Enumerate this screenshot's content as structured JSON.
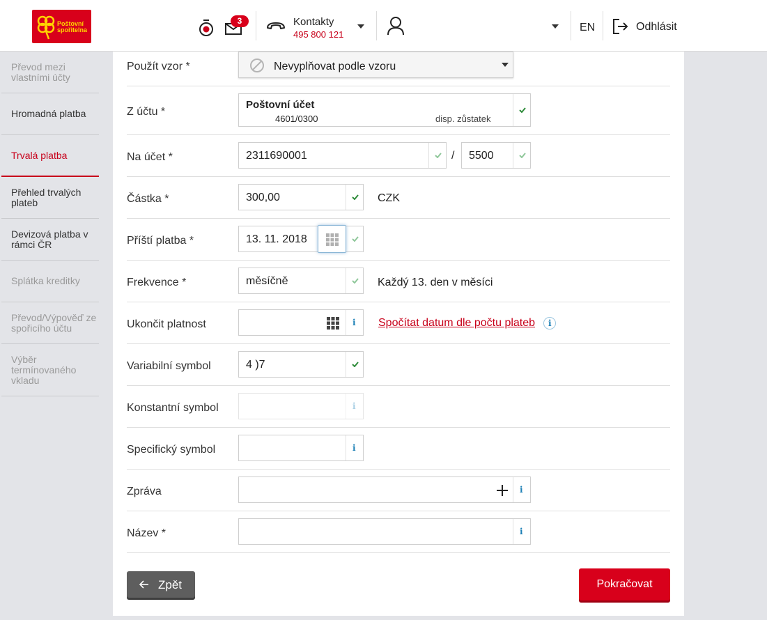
{
  "header": {
    "logo_text_line1": "Poštovní",
    "logo_text_line2": "spořitelna",
    "notification_count": "3",
    "contacts_label": "Kontakty",
    "contacts_phone": "495 800 121",
    "language": "EN",
    "logout_label": "Odhlásit"
  },
  "sidebar": {
    "items": [
      {
        "label": "Převod mezi vlastními účty",
        "state": "muted"
      },
      {
        "label": "Hromadná platba",
        "state": "normal"
      },
      {
        "label": "Trvalá platba",
        "state": "active"
      },
      {
        "label": "Přehled trvalých plateb",
        "state": "normal"
      },
      {
        "label": "Devizová platba v rámci ČR",
        "state": "normal"
      },
      {
        "label": "Splátka kreditky",
        "state": "muted"
      },
      {
        "label": "Převod/Výpověď ze spořicího účtu",
        "state": "muted"
      },
      {
        "label": "Výběr termínovaného vkladu",
        "state": "muted"
      }
    ]
  },
  "form": {
    "template": {
      "label": "Použít vzor *",
      "value": "Nevyplňovat podle vzoru"
    },
    "from_account": {
      "label": "Z účtu *",
      "name": "Poštovní účet",
      "number": "4601/0300",
      "balance_label": "disp. zůstatek"
    },
    "to_account": {
      "label": "Na účet *",
      "number": "2311690001",
      "separator": "/",
      "bank_code": "5500"
    },
    "amount": {
      "label": "Částka *",
      "value": "300,00",
      "currency": "CZK"
    },
    "next_payment": {
      "label": "Příští platba *",
      "value": "13. 11. 2018"
    },
    "frequency": {
      "label": "Frekvence *",
      "value": "měsíčně",
      "description": "Každý 13. den v měsíci"
    },
    "end_validity": {
      "label": "Ukončit platnost",
      "value": "",
      "link": "Spočítat datum dle počtu plateb"
    },
    "variable_symbol": {
      "label": "Variabilní symbol",
      "value": "4   )7"
    },
    "constant_symbol": {
      "label": "Konstantní symbol",
      "value": ""
    },
    "specific_symbol": {
      "label": "Specifický symbol",
      "value": ""
    },
    "message": {
      "label": "Zpráva",
      "value": ""
    },
    "name": {
      "label": "Název *",
      "value": ""
    }
  },
  "actions": {
    "back_label": "Zpět",
    "continue_label": "Pokračovat"
  },
  "colors": {
    "brand_red": "#d8001b",
    "check_green": "#2e8b3a",
    "info_blue": "#1a7fb5"
  },
  "icons": {
    "info": "i"
  }
}
